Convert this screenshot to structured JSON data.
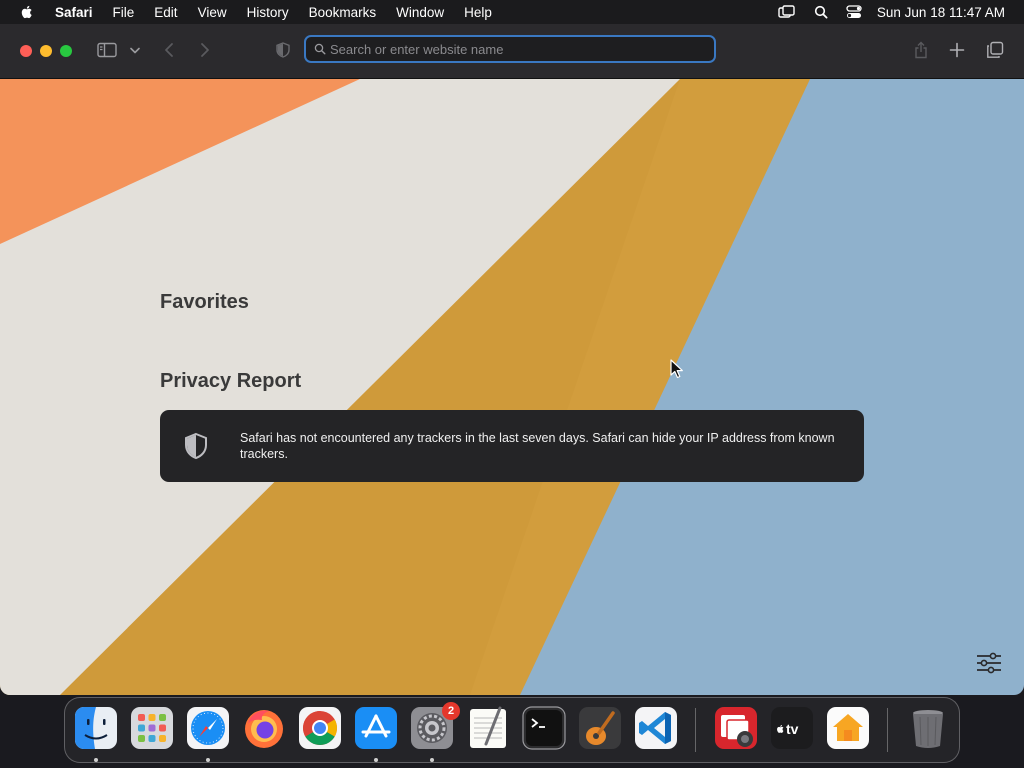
{
  "menubar": {
    "app_name": "Safari",
    "items": [
      "File",
      "Edit",
      "View",
      "History",
      "Bookmarks",
      "Window",
      "Help"
    ],
    "clock": "Sun Jun 18  11:47 AM"
  },
  "toolbar": {
    "search_placeholder": "Search or enter website name",
    "search_value": ""
  },
  "start_page": {
    "favorites_title": "Favorites",
    "privacy_title": "Privacy Report",
    "privacy_text": "Safari has not encountered any trackers in the last seven days. Safari can hide your IP address from known trackers."
  },
  "dock": {
    "apps": [
      "Finder",
      "Launchpad",
      "Safari",
      "Firefox",
      "Google Chrome",
      "App Store",
      "System Settings",
      "TextEdit",
      "Terminal",
      "GarageBand",
      "Visual Studio Code",
      "Photo Booth",
      "Apple TV",
      "Home",
      "Trash"
    ],
    "settings_badge": "2"
  },
  "colors": {
    "accent": "#3a78c2",
    "wallpaper_orange": "#f4935a",
    "wallpaper_cream": "#e3e0da",
    "wallpaper_gold": "#cf9a3a",
    "wallpaper_blue": "#8fb1cc",
    "badge": "#e5372c"
  }
}
